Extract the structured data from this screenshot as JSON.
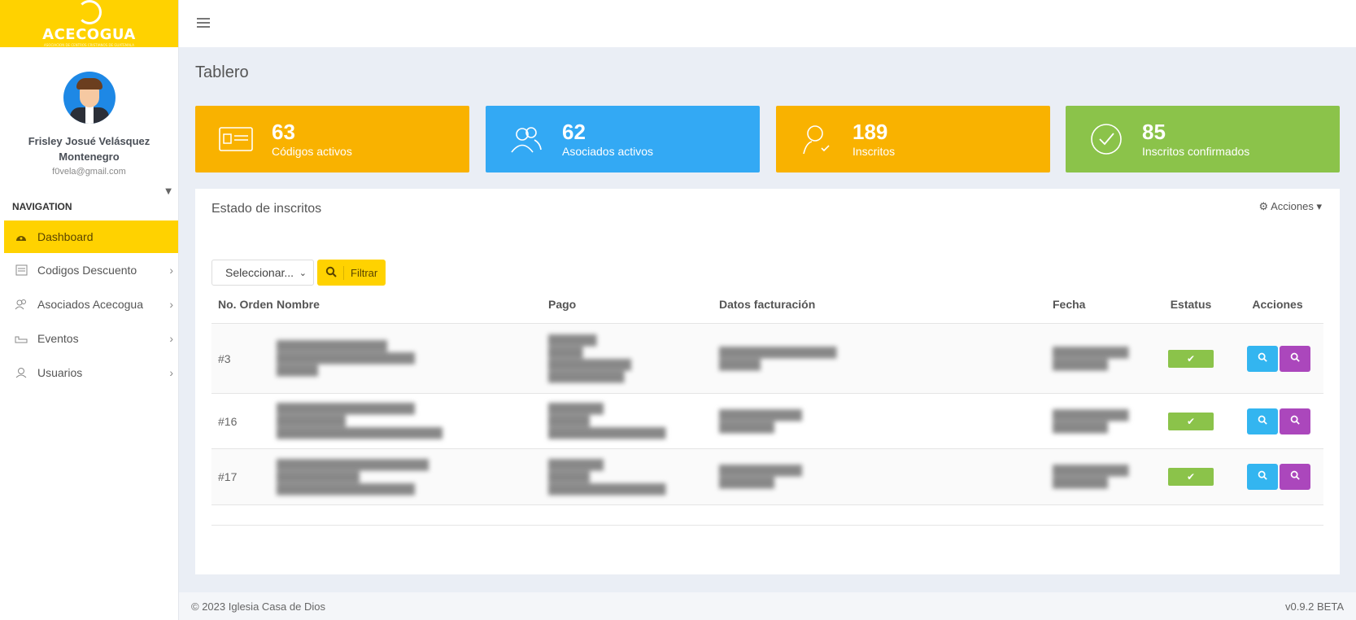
{
  "brand": {
    "name": "ACECOGUA",
    "tagline": "ASOCIACION DE CENTROS CRISTIANOS DE GUATEMALA"
  },
  "profile": {
    "name": "Frisley Josué Velásquez Montenegro",
    "email": "f0vela@gmail.com"
  },
  "nav": {
    "title": "NAVIGATION",
    "items": [
      {
        "label": "Dashboard",
        "icon": "dashboard-icon",
        "active": true
      },
      {
        "label": "Codigos Descuento",
        "icon": "coupon-icon"
      },
      {
        "label": "Asociados Acecogua",
        "icon": "users-icon"
      },
      {
        "label": "Eventos",
        "icon": "calendar-icon"
      },
      {
        "label": "Usuarios",
        "icon": "user-icon"
      }
    ]
  },
  "page": {
    "title": "Tablero"
  },
  "stats": [
    {
      "value": "63",
      "label": "Códigos activos",
      "color": "#f9b200",
      "icon": "card-icon"
    },
    {
      "value": "62",
      "label": "Asociados activos",
      "color": "#33a9f4",
      "icon": "group-icon"
    },
    {
      "value": "189",
      "label": "Inscritos",
      "color": "#f9b200",
      "icon": "person-check-icon"
    },
    {
      "value": "85",
      "label": "Inscritos confirmados",
      "color": "#8bc34a",
      "icon": "check-circle-icon"
    }
  ],
  "panel": {
    "title": "Estado de inscritos",
    "actions_label": "Acciones",
    "select_value": "Seleccionar...",
    "filter_label": "Filtrar"
  },
  "table": {
    "headers": [
      "No. Orden",
      "Nombre",
      "Pago",
      "Datos facturación",
      "Fecha",
      "Estatus",
      "Acciones"
    ],
    "rows": [
      {
        "order": "#3",
        "name": [
          "████████████████",
          "████████████████████",
          "██████"
        ],
        "pago": [
          "███████",
          "█████",
          "████████████",
          "███████████"
        ],
        "datos": [
          "█████████████████",
          "██████"
        ],
        "fecha": [
          "███████████",
          "████████"
        ]
      },
      {
        "order": "#16",
        "name": [
          "████████████████████",
          "██████████",
          "████████████████████████"
        ],
        "pago": [
          "████████",
          "██████",
          "█████████████████"
        ],
        "datos": [
          "████████████",
          "████████"
        ],
        "fecha": [
          "███████████",
          "████████"
        ]
      },
      {
        "order": "#17",
        "name": [
          "██████████████████████",
          "████████████",
          "████████████████████"
        ],
        "pago": [
          "████████",
          "██████",
          "█████████████████"
        ],
        "datos": [
          "████████████",
          "████████"
        ],
        "fecha": [
          "███████████",
          "████████"
        ]
      }
    ]
  },
  "footer": {
    "copyright": "© 2023 Iglesia Casa de Dios",
    "version": "v0.9.2 BETA"
  }
}
